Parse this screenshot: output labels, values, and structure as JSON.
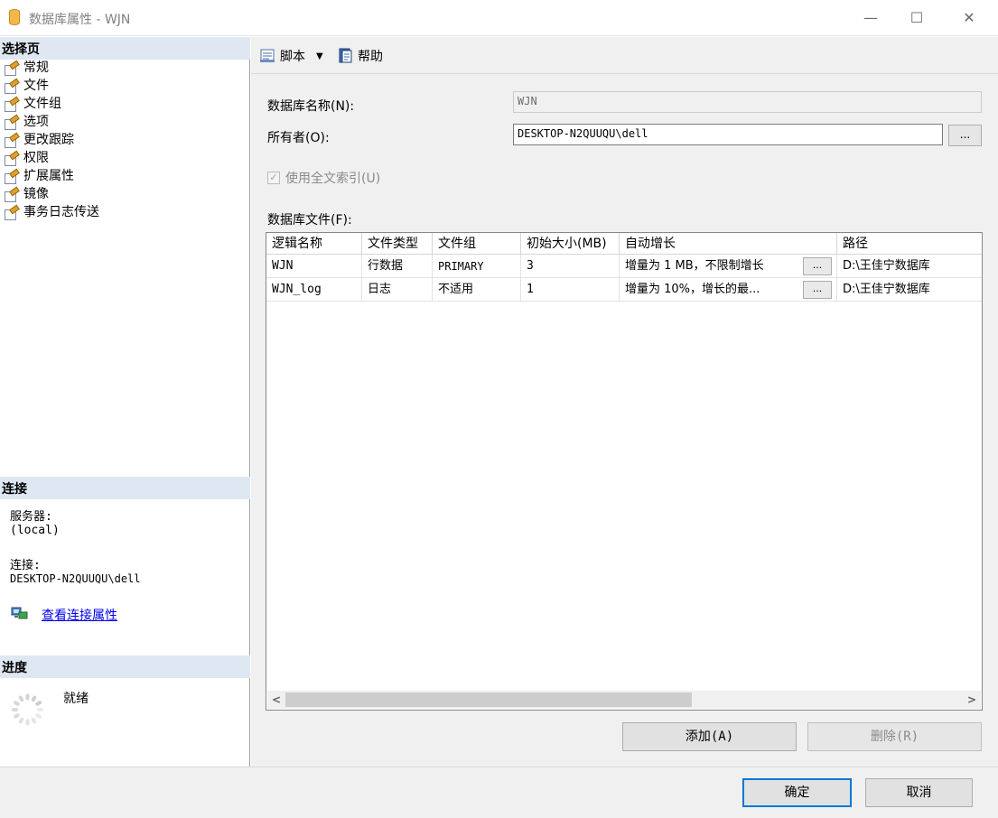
{
  "window": {
    "title": "数据库属性 - WJN",
    "minimize": "—",
    "maximize": "☐",
    "close": "✕"
  },
  "left": {
    "select_page_header": "选择页",
    "nav_items": [
      {
        "label": "常规"
      },
      {
        "label": "文件"
      },
      {
        "label": "文件组"
      },
      {
        "label": "选项"
      },
      {
        "label": "更改跟踪"
      },
      {
        "label": "权限"
      },
      {
        "label": "扩展属性"
      },
      {
        "label": "镜像"
      },
      {
        "label": "事务日志传送"
      }
    ],
    "connection_header": "连接",
    "server_label": "服务器:",
    "server_value": "(local)",
    "connection_label": "连接:",
    "connection_value": "DESKTOP-N2QUUQU\\dell",
    "view_connection_link": "查看连接属性",
    "progress_header": "进度",
    "progress_status": "就绪"
  },
  "toolbar": {
    "script_label": "脚本",
    "help_label": "帮助"
  },
  "form": {
    "db_name_label": "数据库名称(N):",
    "db_name_value": "WJN",
    "owner_label": "所有者(O):",
    "owner_value": "DESKTOP-N2QUUQU\\dell",
    "browse_button": "...",
    "fulltext_label": "使用全文索引(U)",
    "fulltext_checked": true,
    "db_files_label": "数据库文件(F):"
  },
  "files_table": {
    "columns": [
      "逻辑名称",
      "文件类型",
      "文件组",
      "初始大小(MB)",
      "自动增长",
      "路径"
    ],
    "rows": [
      {
        "logical_name": "WJN",
        "file_type": "行数据",
        "filegroup": "PRIMARY",
        "initial_size": "3",
        "autogrowth": "增量为 1 MB，不限制增长",
        "button": "...",
        "path": "D:\\王佳宁数据库"
      },
      {
        "logical_name": "WJN_log",
        "file_type": "日志",
        "filegroup": "不适用",
        "initial_size": "1",
        "autogrowth": "增量为 10%，增长的最...",
        "button": "...",
        "path": "D:\\王佳宁数据库"
      }
    ],
    "scroll_left": "<",
    "scroll_right": ">"
  },
  "buttons": {
    "add": "添加(A)",
    "remove": "删除(R)",
    "ok": "确定",
    "cancel": "取消"
  },
  "colors": {
    "section_header_bg": "#dfe7f2",
    "panel_bg": "#f0f0f0",
    "link": "#0000ee",
    "focus_border": "#0078d7"
  }
}
